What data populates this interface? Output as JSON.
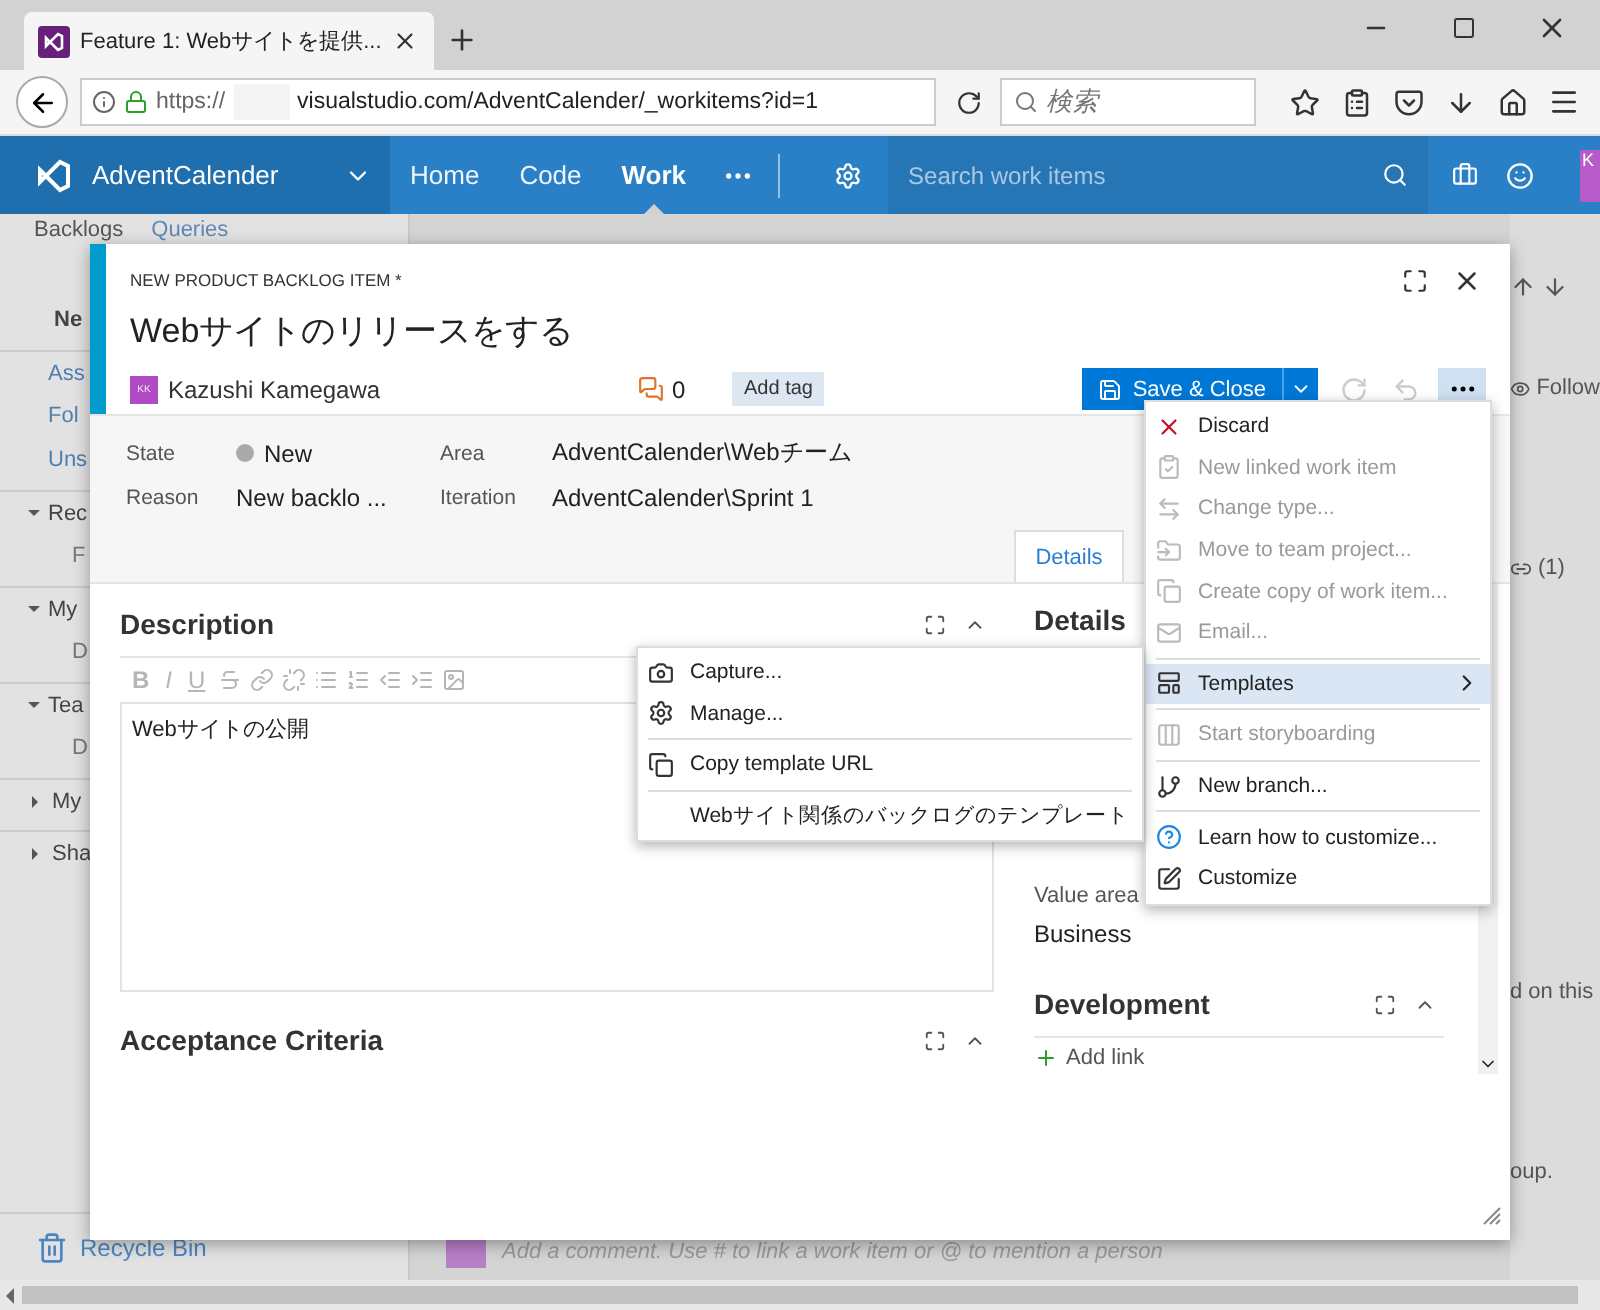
{
  "browser": {
    "tab_title": "Feature 1: Webサイトを提供...",
    "url_scheme": "https://",
    "url_rest": "visualstudio.com/AdventCalender/_workitems?id=1",
    "search_placeholder": "検索"
  },
  "nav": {
    "project": "AdventCalender",
    "items": [
      {
        "label": "Home",
        "selected": false
      },
      {
        "label": "Code",
        "selected": false
      },
      {
        "label": "Work",
        "selected": true
      }
    ],
    "search_placeholder": "Search work items",
    "avatar": "K"
  },
  "hub_tabs": [
    "Backlogs",
    "Queries"
  ],
  "sidebar": [
    {
      "label": "Ne",
      "kind": "heading"
    },
    {
      "label": "Ass",
      "kind": "link"
    },
    {
      "label": "Fol",
      "kind": "link"
    },
    {
      "label": "Uns",
      "kind": "link"
    },
    {
      "label": "Rec",
      "kind": "group",
      "expanded": true
    },
    {
      "label": "F",
      "kind": "leaf"
    },
    {
      "label": "My",
      "kind": "group",
      "expanded": true
    },
    {
      "label": "D",
      "kind": "leaf"
    },
    {
      "label": "Tea",
      "kind": "group",
      "expanded": true
    },
    {
      "label": "D",
      "kind": "leaf"
    },
    {
      "label": "My",
      "kind": "group",
      "expanded": false
    },
    {
      "label": "Sha",
      "kind": "group",
      "expanded": false
    }
  ],
  "recycle_bin": "Recycle Bin",
  "right_fragments": {
    "follow": "Follow",
    "links": "(1)",
    "note_1": "d on this",
    "note_2": "oup."
  },
  "comment_placeholder": "Add a comment. Use # to link a work item or @ to mention a person",
  "work_item": {
    "type": "NEW PRODUCT BACKLOG ITEM *",
    "title": "Webサイトのリリースをする",
    "avatar": "KK",
    "assignee": "Kazushi Kamegawa",
    "comments": "0",
    "add_tag": "Add tag",
    "save": "Save & Close",
    "fields": [
      {
        "label": "State",
        "value": "New"
      },
      {
        "label": "Area",
        "value": "AdventCalender\\Webチーム"
      },
      {
        "label": "Reason",
        "value": "New backlo ..."
      },
      {
        "label": "Iteration",
        "value": "AdventCalender\\Sprint 1"
      }
    ],
    "tabs": [
      {
        "label": "Details",
        "selected": true
      }
    ],
    "description": {
      "heading": "Description",
      "format_buttons": [
        "B",
        "I",
        "U"
      ],
      "content": "Webサイトの公開"
    },
    "acceptance_heading": "Acceptance Criteria",
    "details_heading": "Details",
    "value_area": {
      "label": "Value area",
      "value": "Business"
    },
    "development_heading": "Development",
    "add_link": "Add link"
  },
  "more_menu": {
    "groups": [
      [
        {
          "label": "Discard",
          "disabled": false,
          "selected": false
        },
        {
          "label": "New linked work item",
          "disabled": true,
          "selected": false
        },
        {
          "label": "Change type...",
          "disabled": true,
          "selected": false
        },
        {
          "label": "Move to team project...",
          "disabled": true,
          "selected": false
        },
        {
          "label": "Create copy of work item...",
          "disabled": true,
          "selected": false
        },
        {
          "label": "Email...",
          "disabled": true,
          "selected": false
        }
      ],
      [
        {
          "label": "Templates",
          "disabled": false,
          "selected": true
        }
      ],
      [
        {
          "label": "Start storyboarding",
          "disabled": true,
          "selected": false
        }
      ],
      [
        {
          "label": "New branch...",
          "disabled": false,
          "selected": false
        }
      ],
      [
        {
          "label": "Learn how to customize...",
          "disabled": false,
          "selected": false
        },
        {
          "label": "Customize",
          "disabled": false,
          "selected": false
        }
      ]
    ]
  },
  "templates_submenu": {
    "groups": [
      [
        {
          "label": "Capture..."
        },
        {
          "label": "Manage..."
        }
      ],
      [
        {
          "label": "Copy template URL"
        }
      ],
      [
        {
          "label": "Webサイト関係のバックログのテンプレート"
        }
      ]
    ]
  }
}
